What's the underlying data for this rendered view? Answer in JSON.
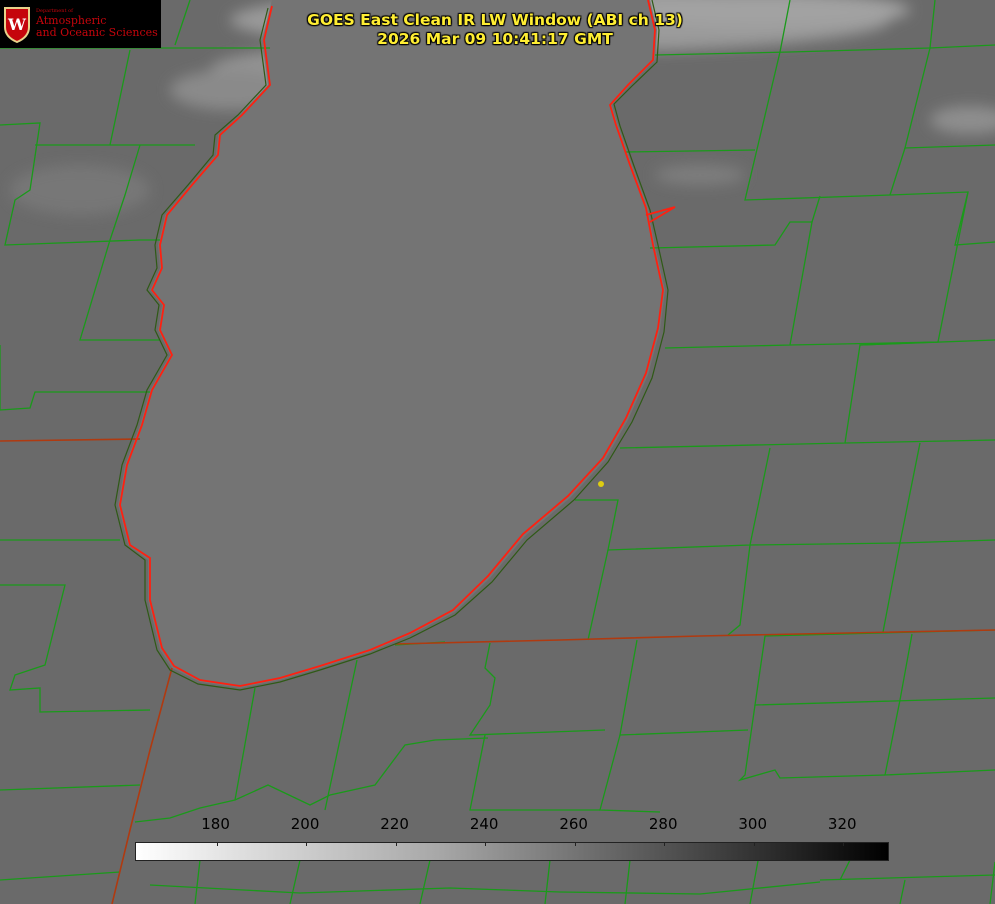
{
  "header": {
    "title_line1": "GOES East Clean IR LW Window (ABI ch 13)",
    "title_line2": "2026 Mar 09 10:41:17 GMT"
  },
  "logo": {
    "dept": "Department of",
    "line1": "Atmospheric",
    "line2": "and Oceanic Sciences",
    "crest_letter": "W",
    "icon": "uw-crest-icon",
    "color": "#c5050c"
  },
  "colorbar": {
    "min": 162,
    "max": 330,
    "ticks": [
      180,
      200,
      220,
      240,
      260,
      280,
      300,
      320
    ],
    "low_color": "#ffffff",
    "high_color": "#000000"
  },
  "map": {
    "lake": "Lake Michigan",
    "lake_fill": "#747474",
    "land_fill": "#6a6a6a",
    "county_line_color": "#1a9a1a",
    "state_line_color": "#b03a10",
    "coastline_color": "#ff2010",
    "marker_color": "#ddcc11"
  }
}
